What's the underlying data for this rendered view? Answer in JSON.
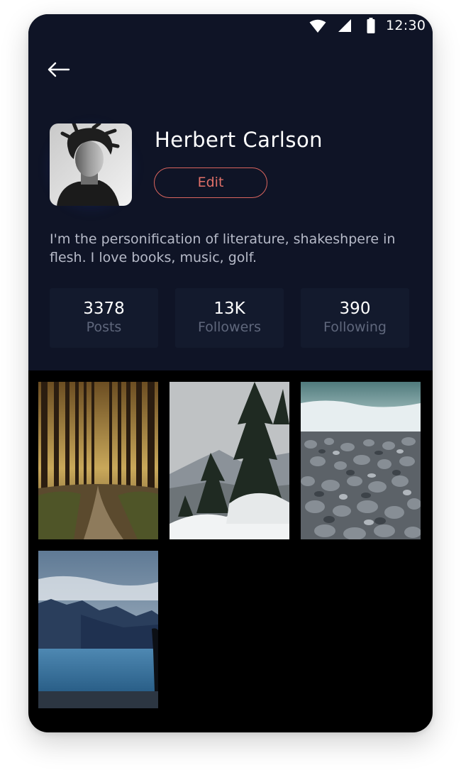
{
  "status_bar": {
    "time": "12:30"
  },
  "profile": {
    "name": "Herbert Carlson",
    "edit_label": "Edit",
    "bio": "I'm the personification of literature, shakeshpere in flesh. I love books, music, golf."
  },
  "stats": [
    {
      "value": "3378",
      "label": "Posts"
    },
    {
      "value": "13K",
      "label": "Followers"
    },
    {
      "value": "390",
      "label": "Following"
    }
  ],
  "gallery": [
    {
      "subject": "forest path"
    },
    {
      "subject": "snowy pine trees"
    },
    {
      "subject": "pebble beach"
    },
    {
      "subject": "mountain lake"
    }
  ],
  "colors": {
    "header_bg": "#0f1426",
    "accent": "#e07068",
    "stat_bg": "#131a2d"
  }
}
